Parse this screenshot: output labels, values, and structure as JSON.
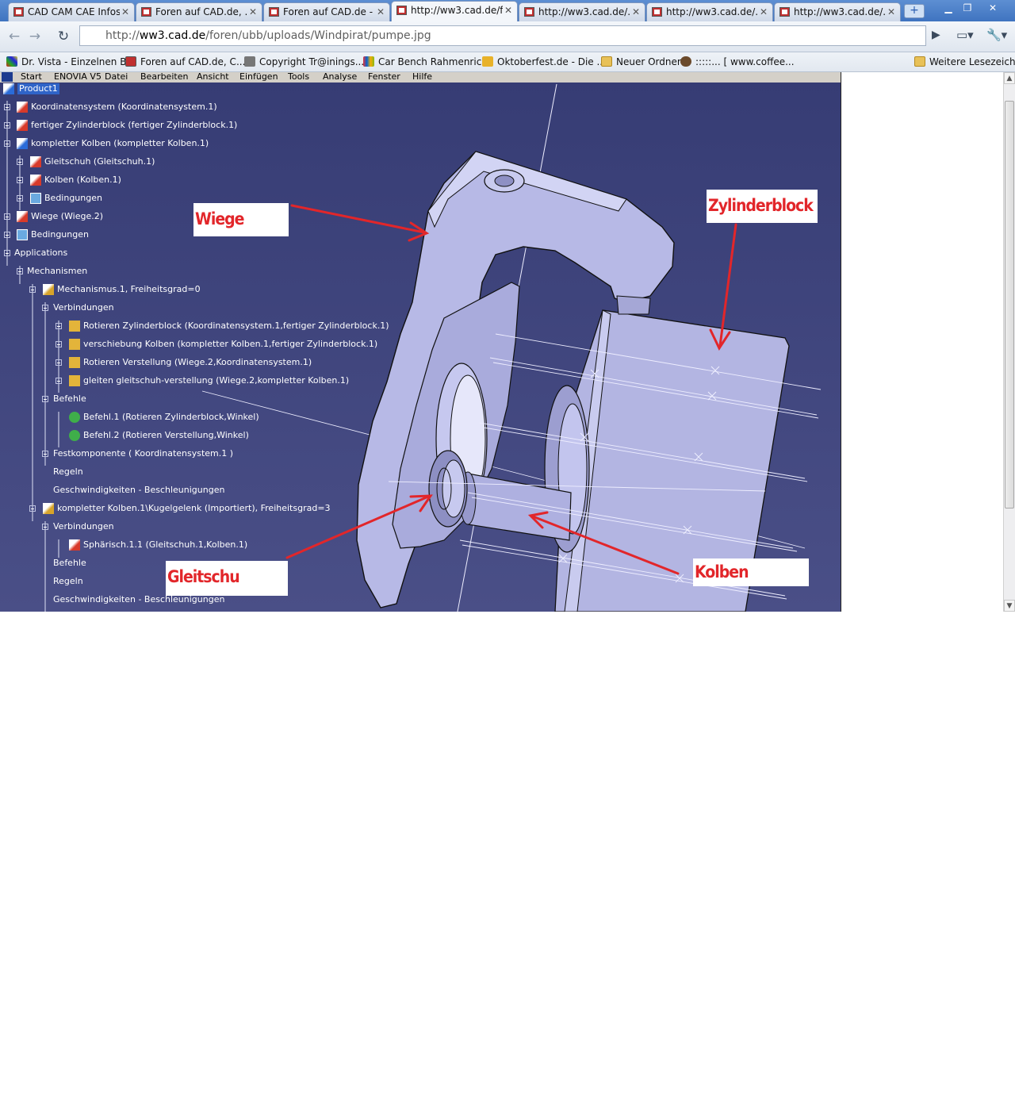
{
  "tabs": [
    {
      "label": "CAD CAM CAE Infos..."
    },
    {
      "label": "Foren auf CAD.de, ..."
    },
    {
      "label": "Foren auf CAD.de - ..."
    },
    {
      "label": "http://ww3.cad.de/f..."
    },
    {
      "label": "http://ww3.cad.de/..."
    },
    {
      "label": "http://ww3.cad.de/..."
    },
    {
      "label": "http://ww3.cad.de/..."
    }
  ],
  "address": {
    "scheme": "http://",
    "host": "ww3.cad.de",
    "path": "/foren/ubb/uploads/Windpirat/pumpe.jpg"
  },
  "bookmarks": [
    {
      "label": "Dr. Vista - Einzelnen B..."
    },
    {
      "label": "Foren auf CAD.de, C..."
    },
    {
      "label": "Copyright Tr@inings..."
    },
    {
      "label": "Car Bench Rahmenric..."
    },
    {
      "label": "Oktoberfest.de - Die ..."
    },
    {
      "label": "Neuer Ordner"
    },
    {
      "label": ":::::... [ www.coffee..."
    }
  ],
  "other_bookmarks": "Weitere Lesezeichen",
  "catia_menu": [
    "Start",
    "ENOVIA V5",
    "Datei",
    "Bearbeiten",
    "Ansicht",
    "Einfügen",
    "Tools",
    "Analyse",
    "Fenster",
    "Hilfe"
  ],
  "tree": [
    "Product1",
    "Koordinatensystem (Koordinatensystem.1)",
    "fertiger Zylinderblock (fertiger Zylinderblock.1)",
    "kompletter Kolben (kompletter Kolben.1)",
    "Gleitschuh (Gleitschuh.1)",
    "Kolben (Kolben.1)",
    "Bedingungen",
    "Wiege (Wiege.2)",
    "Bedingungen",
    "Applications",
    "Mechanismen",
    "Mechanismus.1, Freiheitsgrad=0",
    "Verbindungen",
    "Rotieren Zylinderblock (Koordinatensystem.1,fertiger Zylinderblock.1)",
    "verschiebung Kolben (kompletter Kolben.1,fertiger Zylinderblock.1)",
    "Rotieren Verstellung (Wiege.2,Koordinatensystem.1)",
    "gleiten gleitschuh-verstellung (Wiege.2,kompletter Kolben.1)",
    "Befehle",
    "Befehl.1 (Rotieren Zylinderblock,Winkel)",
    "Befehl.2 (Rotieren Verstellung,Winkel)",
    "Festkomponente ( Koordinatensystem.1 )",
    "Regeln",
    "Geschwindigkeiten - Beschleunigungen",
    "kompletter Kolben.1\\Kugelgelenk (Importiert), Freiheitsgrad=3",
    "Verbindungen",
    "Sphärisch.1.1 (Gleitschuh.1,Kolben.1)",
    "Befehle",
    "Regeln",
    "Geschwindigkeiten - Beschleunigungen"
  ],
  "annotations": {
    "wiege": "Wiege",
    "zylinderblock": "Zylinderblock",
    "gleitschuh": "Gleitschu",
    "kolben": "Kolben"
  },
  "colors": {
    "cad_bg": "#3d4379",
    "annotation": "#e2262a",
    "part": "#b7b9e6"
  }
}
